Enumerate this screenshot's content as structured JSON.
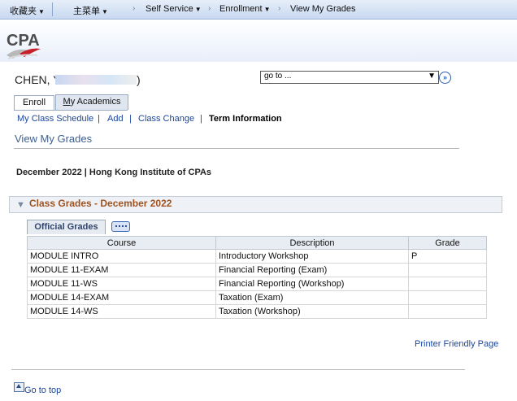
{
  "nav": {
    "favorites": "收藏夹",
    "main_menu": "主菜单",
    "self_service": "Self Service",
    "enrollment": "Enrollment",
    "view_my_grades": "View My Grades"
  },
  "brand": {
    "logo": "CPA"
  },
  "user": {
    "name_visible": "CHEN, Y",
    "name_tail": ")"
  },
  "goto": {
    "value": "go to ...",
    "button": "»"
  },
  "tabs": [
    {
      "label": "Enroll"
    },
    {
      "label_prefix": "M",
      "label_rest": "y Academics"
    }
  ],
  "subnav": {
    "my_class_schedule": "My Class Schedule",
    "add": "Add",
    "class_change": "Class Change",
    "term_information": "Term Information",
    "sep": "|"
  },
  "page": {
    "title": "View My Grades"
  },
  "term": {
    "label": "December 2022 | Hong Kong Institute of CPAs"
  },
  "class_grades": {
    "title": "Class Grades - December 2022",
    "tab_label": "Official Grades",
    "columns": {
      "course": "Course",
      "description": "Description",
      "grade": "Grade"
    },
    "rows": [
      {
        "course": "MODULE INTRO",
        "description": "Introductory Workshop",
        "grade": "P"
      },
      {
        "course": "MODULE 11-EXAM",
        "description": "Financial Reporting (Exam)",
        "grade": ""
      },
      {
        "course": "MODULE 11-WS",
        "description": "Financial Reporting (Workshop)",
        "grade": ""
      },
      {
        "course": "MODULE 14-EXAM",
        "description": "Taxation (Exam)",
        "grade": ""
      },
      {
        "course": "MODULE 14-WS",
        "description": "Taxation (Workshop)",
        "grade": ""
      }
    ]
  },
  "footer": {
    "printer_friendly": "Printer Friendly Page",
    "go_to_top": "Go to top"
  },
  "colors": {
    "link": "#1a46a0",
    "group_title": "#a0521f",
    "logo_red": "#c8202a"
  }
}
